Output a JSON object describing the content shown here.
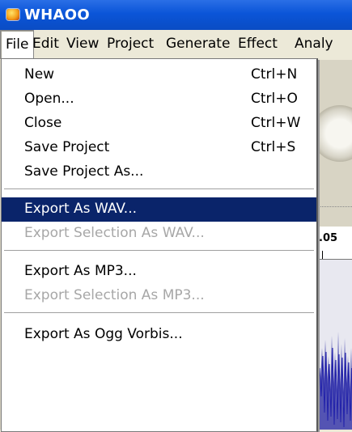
{
  "window": {
    "title": "WHAOO",
    "icon": "audacity-app-icon"
  },
  "menubar": [
    "File",
    "Edit",
    "View",
    "Project",
    "Generate",
    "Effect",
    "Analy"
  ],
  "file_menu": {
    "groups": [
      [
        {
          "label": "New",
          "shortcut": "Ctrl+N",
          "enabled": true
        },
        {
          "label": "Open...",
          "shortcut": "Ctrl+O",
          "enabled": true
        },
        {
          "label": "Close",
          "shortcut": "Ctrl+W",
          "enabled": true
        },
        {
          "label": "Save Project",
          "shortcut": "Ctrl+S",
          "enabled": true
        },
        {
          "label": "Save Project As...",
          "shortcut": "",
          "enabled": true
        }
      ],
      [
        {
          "label": "Export As WAV...",
          "shortcut": "",
          "enabled": true,
          "highlighted": true
        },
        {
          "label": "Export Selection As WAV...",
          "shortcut": "",
          "enabled": false
        }
      ],
      [
        {
          "label": "Export As MP3...",
          "shortcut": "",
          "enabled": true
        },
        {
          "label": "Export Selection As MP3...",
          "shortcut": "",
          "enabled": false
        }
      ],
      [
        {
          "label": "Export As Ogg Vorbis...",
          "shortcut": "",
          "enabled": true
        }
      ]
    ]
  },
  "timeline": {
    "ruler_label": ".05"
  },
  "colors": {
    "title_bar": "#0b55d8",
    "highlight": "#0a246a",
    "disabled_text": "#a7a7a7",
    "waveform": "#3a3aa8"
  }
}
